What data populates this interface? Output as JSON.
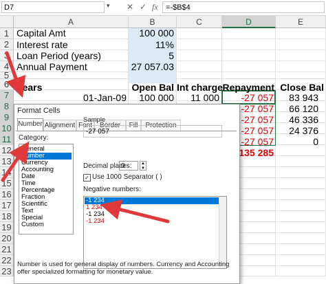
{
  "formula_bar": {
    "name_box": "D7",
    "cancel_icon": "✕",
    "enter_icon": "✓",
    "fx_icon": "fx",
    "formula": "=-$B$4"
  },
  "columns": [
    "A",
    "B",
    "C",
    "D",
    "E"
  ],
  "rows": [
    "1",
    "2",
    "3",
    "4",
    "5",
    "6",
    "7",
    "8",
    "9",
    "10",
    "11",
    "12",
    "13",
    "14",
    "15",
    "16",
    "17",
    "18",
    "19",
    "20",
    "21",
    "22",
    "23"
  ],
  "cells": {
    "a1": "Capital Amt",
    "b1": "100 000",
    "a2": "Interest rate",
    "b2": "11%",
    "a3": "Loan Period (years)",
    "b3": "5",
    "a4": "Annual Payment",
    "b4": "27 057.03",
    "a6": "Years",
    "b6": "Open Bal",
    "c6": "Int charge",
    "d6": "Repayment",
    "e6": "Close Bal",
    "a7": "01-Jan-09",
    "b7": "100 000",
    "c7": "11 000",
    "d7": "-27 057",
    "e7": "83 943",
    "d8": "-27 057",
    "e8": "66 120",
    "d9": "-27 057",
    "e9": "46 336",
    "d10": "-27 057",
    "e10": "24 376",
    "d11": "-27 057",
    "e11": "0",
    "d12": "-135 285"
  },
  "dialog": {
    "title": "Format Cells",
    "tabs": [
      "Number",
      "Alignment",
      "Font",
      "Border",
      "Fill",
      "Protection"
    ],
    "active_tab": "Number",
    "category_label": "Category:",
    "categories": [
      "General",
      "Number",
      "Currency",
      "Accounting",
      "Date",
      "Time",
      "Percentage",
      "Fraction",
      "Scientific",
      "Text",
      "Special",
      "Custom"
    ],
    "selected_category": "Number",
    "sample_label": "Sample",
    "sample_value": "-27 057",
    "decimal_label": "Decimal places:",
    "decimal_value": "0",
    "separator_label": "Use 1000 Separator ( )",
    "separator_checked": true,
    "negative_label": "Negative numbers:",
    "negative_options": [
      "-1 234",
      "1 234",
      "-1 234",
      "-1 234"
    ],
    "negative_option_colors": [
      "#ffffff",
      "#e00000",
      "#222222",
      "#e00000"
    ],
    "selected_negative": 0,
    "description": "Number is used for general display of numbers.  Currency and Accounting offer specialized formatting for monetary value."
  },
  "colors": {
    "accent": "#217346",
    "input_fill": "#dde9f6",
    "negative_red": "#e00000",
    "arrow_red": "#e0393b",
    "selection_blue": "#0078d7"
  }
}
